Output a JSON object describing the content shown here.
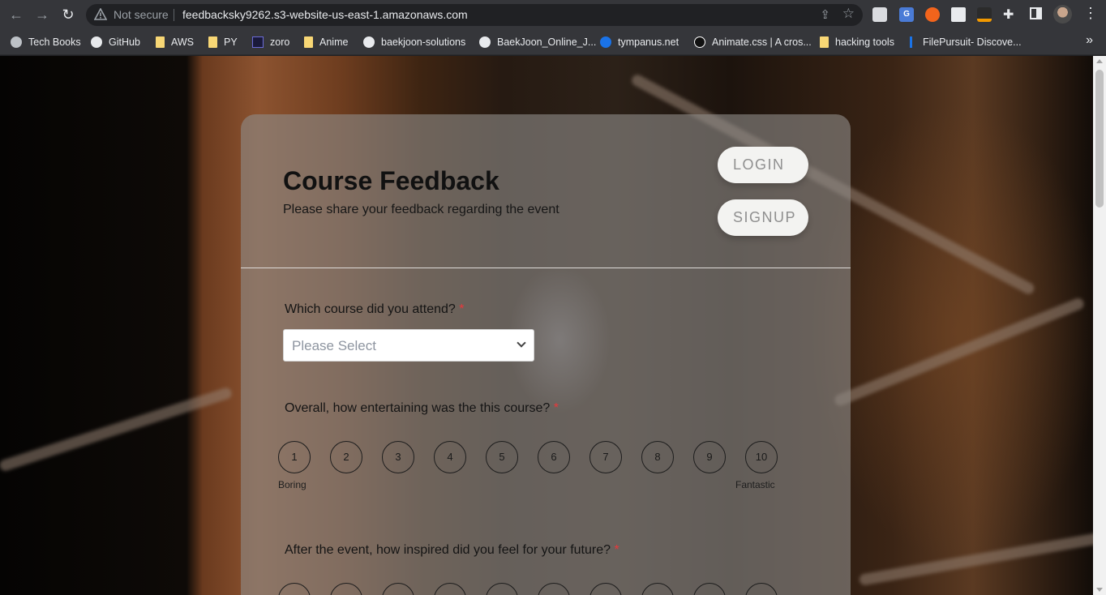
{
  "browser": {
    "security_label": "Not secure",
    "url": "feedbacksky9262.s3-website-us-east-1.amazonaws.com",
    "bookmarks": [
      {
        "label": "Tech Books",
        "icon": "globe-icon"
      },
      {
        "label": "GitHub",
        "icon": "github-icon"
      },
      {
        "label": "AWS",
        "icon": "folder-icon"
      },
      {
        "label": "PY",
        "icon": "folder-icon"
      },
      {
        "label": "zoro",
        "icon": "zoro-icon"
      },
      {
        "label": "Anime",
        "icon": "folder-icon"
      },
      {
        "label": "baekjoon-solutions",
        "icon": "github-icon"
      },
      {
        "label": "BaekJoon_Online_J...",
        "icon": "github-icon"
      },
      {
        "label": "tympanus.net",
        "icon": "tympanus-icon"
      },
      {
        "label": "Animate.css | A cros...",
        "icon": "animate-icon"
      },
      {
        "label": "hacking tools",
        "icon": "folder-icon"
      },
      {
        "label": "FilePursuit- Discove...",
        "icon": "filepursuit-icon"
      }
    ],
    "more_label": "»"
  },
  "form": {
    "title": "Course Feedback",
    "subtitle": "Please share your feedback regarding the event",
    "login_label": "LOGIN",
    "signup_label": "SIGNUP",
    "required_mark": "*",
    "q1": {
      "label": "Which course did you attend?",
      "placeholder": "Please Select"
    },
    "q2": {
      "label": "Overall, how entertaining was the this course?",
      "options": [
        "1",
        "2",
        "3",
        "4",
        "5",
        "6",
        "7",
        "8",
        "9",
        "10"
      ],
      "low_label": "Boring",
      "high_label": "Fantastic"
    },
    "q3": {
      "label": "After the event, how inspired did you feel for your future?"
    }
  },
  "colors": {
    "required": "#e8383b",
    "pill_text": "#8f8f8f",
    "select_placeholder": "#8e95a0"
  }
}
